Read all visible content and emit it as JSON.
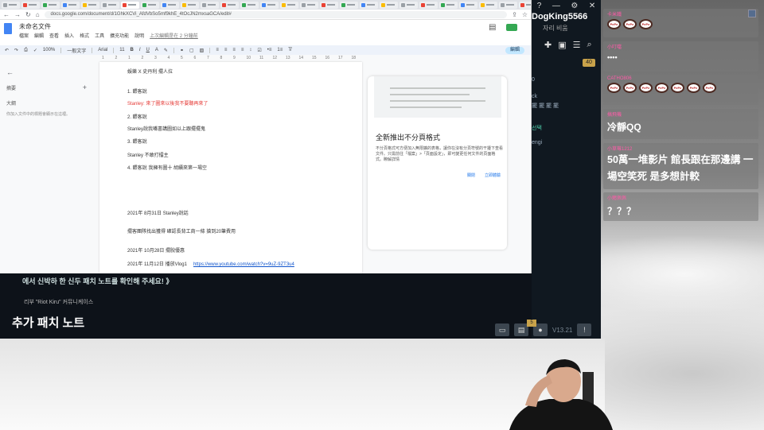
{
  "browser": {
    "tab_count": 34,
    "url": "docs.google.com/document/d/1GhkXCVi_AfdVbSo5mf9khE_4tOcJN2mxsaGCA/edit#",
    "nav": {
      "back": "←",
      "forward": "→",
      "reload": "↻",
      "home": "⌂"
    }
  },
  "docs": {
    "title": "未命名文件",
    "menus": [
      "檔案",
      "編輯",
      "查看",
      "插入",
      "格式",
      "工具",
      "擴充功能",
      "說明"
    ],
    "last_edit": "上次編輯是在 2 分鐘前",
    "toolbar": {
      "zoom": "100%",
      "style": "一般文字",
      "font": "Arial",
      "size": "11",
      "edit_mode": "編輯"
    },
    "ruler": [
      "1",
      "2",
      "1",
      "2",
      "3",
      "4",
      "5",
      "6",
      "7",
      "8",
      "9",
      "10",
      "11",
      "12",
      "13",
      "14",
      "15",
      "16",
      "17",
      "18"
    ],
    "outline": {
      "title": "摘要",
      "section": "大綱",
      "hint": "你加入文件中的標題會顯示在這裡。"
    },
    "lines": [
      {
        "text": "娛樂 X 史丹利  擺人拉",
        "color": "normal"
      },
      {
        "text": "1. 餵客說",
        "color": "normal"
      },
      {
        "text": "Stanley: 來了圖來以後我不要聽再來了",
        "color": "red"
      },
      {
        "text": "2. 餵客說",
        "color": "normal"
      },
      {
        "text": "Stanley說我嘴書講圖如以上跟擺擺鬼",
        "color": "normal"
      },
      {
        "text": "3. 餵客說",
        "color": "normal"
      },
      {
        "text": "Stanley 不敢打擂主",
        "color": "normal"
      },
      {
        "text": "4. 餵客說  我擁有圖十  胡續來第一場空",
        "color": "normal"
      },
      {
        "text": "2021年  8月31日  Stanley說話",
        "color": "normal"
      },
      {
        "text": "擺客團隊找出獲得  確認長背工商一條  搶到20筆費用",
        "color": "normal"
      },
      {
        "text": "2021年  10月28日  擺脫優惠",
        "color": "normal"
      },
      {
        "text": "2021年  11月12日  播放Vlog1",
        "color": "normal",
        "link": "https://www.youtube.com/watch?v=9uZ-9ZT3u4"
      }
    ],
    "promo": {
      "title": "全新推出不分頁格式",
      "description": "不分頁格式可方便加入無限擴的表格，讓你在沒有分頁符號的干擾下查看文件。只需前往「檔案」>「頁面設定」，即可變更任何文件的頁面格式。瞭解詳情",
      "dismiss": "關閉",
      "try": "立即體驗"
    }
  },
  "client": {
    "username": "DogKing5566",
    "sub": "자리 비움",
    "badge": "40",
    "right_lines": [
      "0",
      "ck",
      "擺 擺 擺 擺",
      "선택",
      "engi"
    ],
    "headline": "에서 신박하 한 신두 패치 노트를 확인해 주세요! 》",
    "small": "리부 \"Riot Kiru\" 커뮤니케이스",
    "title": "추가 패치 노트",
    "version": "V13.21",
    "notif_count": "5",
    "window_controls": [
      "?",
      "—",
      "⚙",
      "✕"
    ]
  },
  "chat": [
    {
      "user": "卡米鐵",
      "text": "",
      "emotes": 3
    },
    {
      "user": "小叮噹",
      "text": "••••",
      "emotes": 0
    },
    {
      "user": "CATHO806",
      "text": "",
      "emotes": 7
    },
    {
      "user": "搞飛機",
      "text": "冷靜QQ",
      "emotes": 0
    },
    {
      "user": "小草莓1212",
      "text": "50萬一堆影片 館長跟在那邊講 一場空笑死 是多想計較",
      "emotes": 0
    },
    {
      "user": "小豬佩佩",
      "text": "？？？",
      "emotes": 0
    }
  ],
  "emote_label": "PePe"
}
